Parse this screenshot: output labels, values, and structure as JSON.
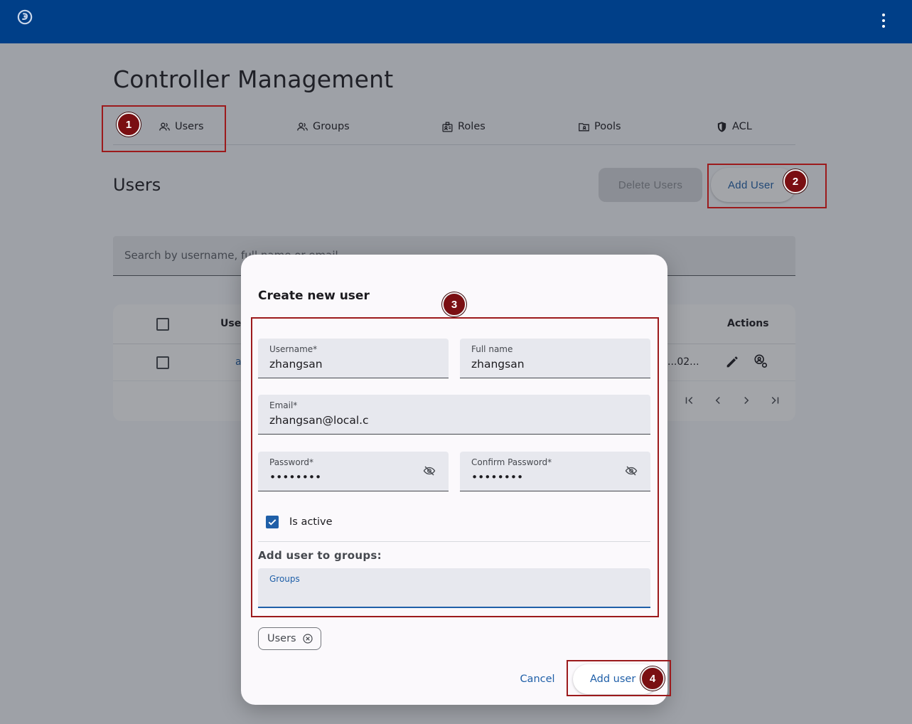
{
  "page": {
    "title": "Controller Management"
  },
  "tabs": [
    {
      "label": "Users",
      "icon": "users-icon"
    },
    {
      "label": "Groups",
      "icon": "groups-icon"
    },
    {
      "label": "Roles",
      "icon": "roles-icon"
    },
    {
      "label": "Pools",
      "icon": "pools-icon"
    },
    {
      "label": "ACL",
      "icon": "shield-icon"
    }
  ],
  "users_section": {
    "title": "Users",
    "delete_label": "Delete Users",
    "add_label": "Add User",
    "search_placeholder": "Search by username, full name or email",
    "table": {
      "headers": {
        "user": "User",
        "actions": "Actions"
      },
      "rows": [
        {
          "user": "a",
          "date": "...02..."
        }
      ]
    }
  },
  "dialog": {
    "title": "Create new user",
    "username": {
      "label": "Username*",
      "value": "zhangsan"
    },
    "fullname": {
      "label": "Full name",
      "value": "zhangsan"
    },
    "email": {
      "label": "Email*",
      "value": "zhangsan@local.c"
    },
    "password": {
      "label": "Password*",
      "value": "••••••••"
    },
    "confirm_password": {
      "label": "Confirm Password*",
      "value": "••••••••"
    },
    "is_active": {
      "label": "Is active",
      "checked": true
    },
    "groups_heading": "Add user to groups:",
    "groups_field": {
      "label": "Groups",
      "value": ""
    },
    "chips": [
      "Users"
    ],
    "cancel_label": "Cancel",
    "submit_label": "Add user"
  },
  "annotations": {
    "color": "#9c1a1c",
    "markers": [
      "1",
      "2",
      "3",
      "4"
    ]
  }
}
